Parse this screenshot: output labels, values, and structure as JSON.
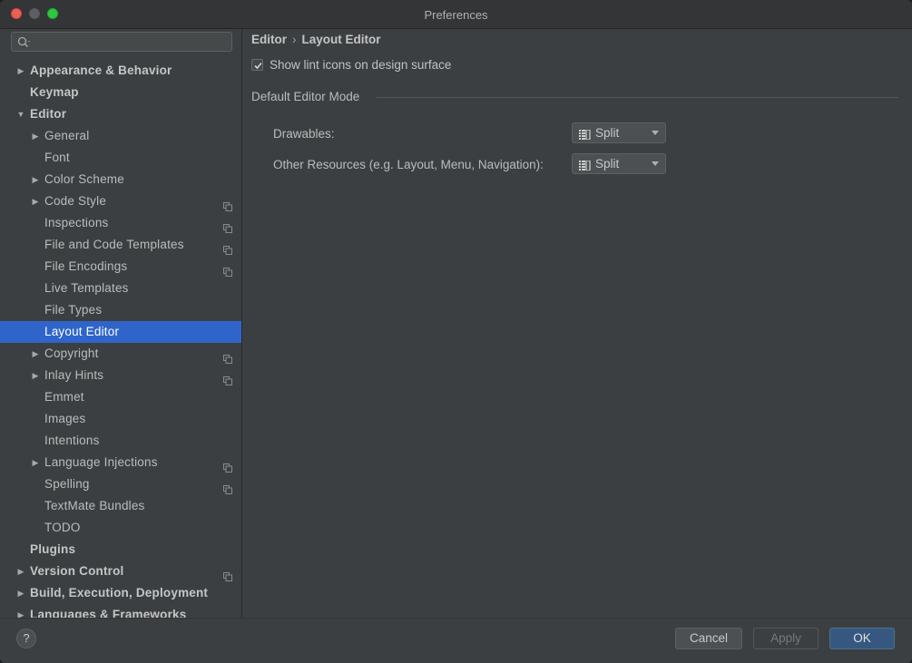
{
  "window": {
    "title": "Preferences"
  },
  "search": {
    "placeholder": ""
  },
  "tree": [
    {
      "label": "Appearance & Behavior",
      "level": 0,
      "arrow": "right",
      "bold": true
    },
    {
      "label": "Keymap",
      "level": 0,
      "arrow": "",
      "bold": true
    },
    {
      "label": "Editor",
      "level": 0,
      "arrow": "down",
      "bold": true
    },
    {
      "label": "General",
      "level": 1,
      "arrow": "right"
    },
    {
      "label": "Font",
      "level": 1,
      "arrow": ""
    },
    {
      "label": "Color Scheme",
      "level": 1,
      "arrow": "right"
    },
    {
      "label": "Code Style",
      "level": 1,
      "arrow": "right",
      "project": true
    },
    {
      "label": "Inspections",
      "level": 1,
      "arrow": "",
      "project": true
    },
    {
      "label": "File and Code Templates",
      "level": 1,
      "arrow": "",
      "project": true
    },
    {
      "label": "File Encodings",
      "level": 1,
      "arrow": "",
      "project": true
    },
    {
      "label": "Live Templates",
      "level": 1,
      "arrow": ""
    },
    {
      "label": "File Types",
      "level": 1,
      "arrow": ""
    },
    {
      "label": "Layout Editor",
      "level": 1,
      "arrow": "",
      "selected": true
    },
    {
      "label": "Copyright",
      "level": 1,
      "arrow": "right",
      "project": true
    },
    {
      "label": "Inlay Hints",
      "level": 1,
      "arrow": "right",
      "project": true
    },
    {
      "label": "Emmet",
      "level": 1,
      "arrow": ""
    },
    {
      "label": "Images",
      "level": 1,
      "arrow": ""
    },
    {
      "label": "Intentions",
      "level": 1,
      "arrow": ""
    },
    {
      "label": "Language Injections",
      "level": 1,
      "arrow": "right",
      "project": true
    },
    {
      "label": "Spelling",
      "level": 1,
      "arrow": "",
      "project": true
    },
    {
      "label": "TextMate Bundles",
      "level": 1,
      "arrow": ""
    },
    {
      "label": "TODO",
      "level": 1,
      "arrow": ""
    },
    {
      "label": "Plugins",
      "level": 0,
      "arrow": "",
      "bold": true
    },
    {
      "label": "Version Control",
      "level": 0,
      "arrow": "right",
      "bold": true,
      "project": true
    },
    {
      "label": "Build, Execution, Deployment",
      "level": 0,
      "arrow": "right",
      "bold": true
    },
    {
      "label": "Languages & Frameworks",
      "level": 0,
      "arrow": "right",
      "bold": true
    }
  ],
  "content": {
    "breadcrumb": {
      "parent": "Editor",
      "separator": "›",
      "current": "Layout Editor"
    },
    "show_lint": {
      "label": "Show lint icons on design surface",
      "checked": true
    },
    "group_title": "Default Editor Mode",
    "fields": [
      {
        "label": "Drawables:",
        "value": "Split"
      },
      {
        "label": "Other Resources (e.g. Layout, Menu, Navigation):",
        "value": "Split"
      }
    ]
  },
  "footer": {
    "help_label": "?",
    "cancel_label": "Cancel",
    "apply_label": "Apply",
    "ok_label": "OK"
  },
  "colors": {
    "selection": "#2f65ca",
    "ok_button": "#365880",
    "background": "#3c3f41"
  }
}
